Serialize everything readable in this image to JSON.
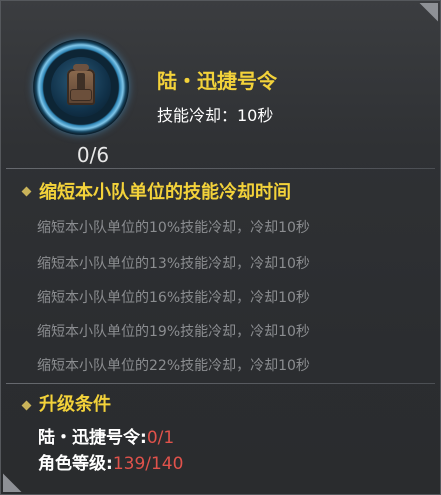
{
  "skill": {
    "name": "陆・迅捷号令",
    "cooldown_text": "技能冷却：10秒",
    "level_count": "0/6",
    "icon": "backpack-icon"
  },
  "description": {
    "heading": "缩短本小队单位的技能冷却时间",
    "levels": [
      "缩短本小队单位的10%技能冷却，冷却10秒",
      "缩短本小队单位的13%技能冷却，冷却10秒",
      "缩短本小队单位的16%技能冷却，冷却10秒",
      "缩短本小队单位的19%技能冷却，冷却10秒",
      "缩短本小队单位的22%技能冷却，冷却10秒"
    ]
  },
  "upgrade": {
    "heading": "升级条件",
    "requirements": [
      {
        "label": "陆・迅捷号令",
        "current": "0",
        "max": "/1"
      },
      {
        "label": "角色等级",
        "current": "139",
        "max": "/140"
      }
    ]
  },
  "colors": {
    "accent": "#f3d23a",
    "unmet": "#e0524b",
    "muted_text": "#8b8d90"
  }
}
